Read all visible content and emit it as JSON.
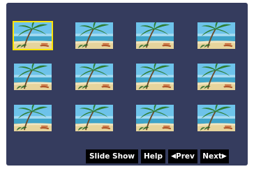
{
  "thumbnails": {
    "rows": 3,
    "columns": 4,
    "selected_index": 0,
    "image": "beach-palm-photo",
    "selection_color": "#ffe300"
  },
  "controls": {
    "slideshow_label": "Slide Show",
    "help_label": "Help",
    "prev_label": "Prev",
    "next_label": "Next",
    "prev_icon": "triangle-left-icon",
    "next_icon": "triangle-right-icon"
  },
  "colors": {
    "panel_bg": "#353c5e",
    "button_bg": "#000000",
    "button_text": "#ffffff"
  }
}
